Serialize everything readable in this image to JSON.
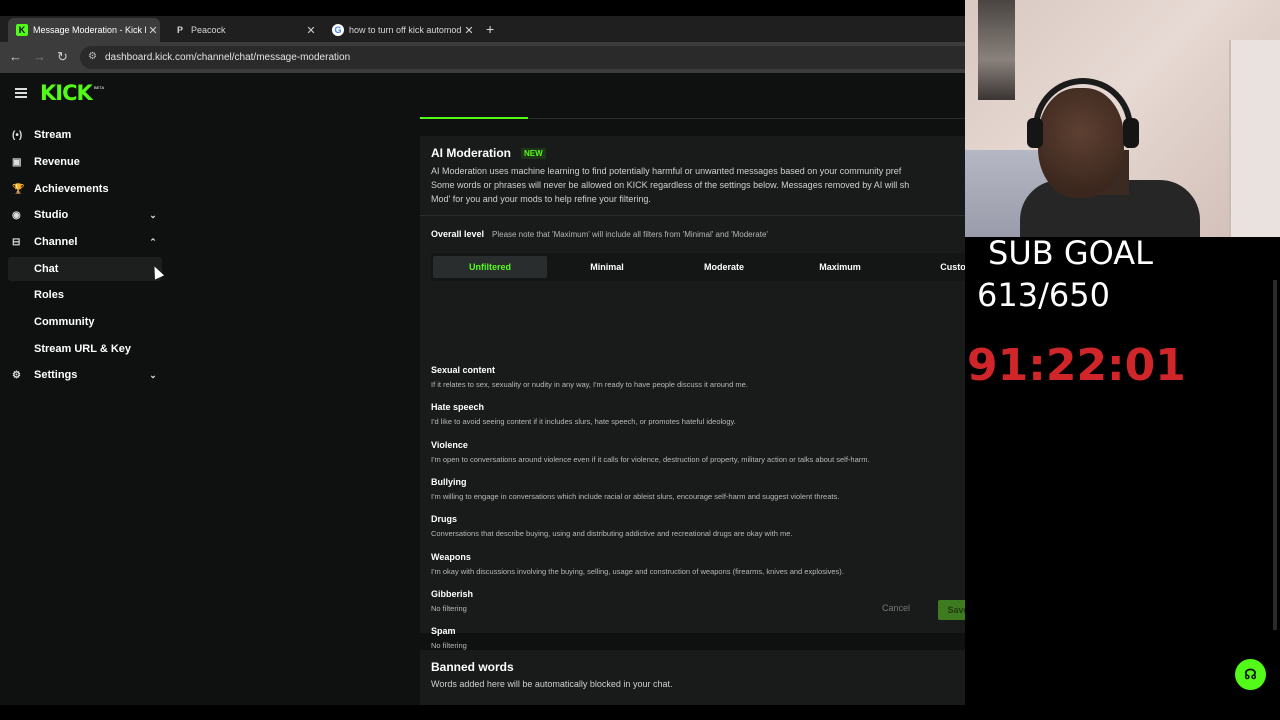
{
  "browser": {
    "tabs": [
      {
        "favicon": "K",
        "favicon_color": "#53fc18",
        "label": "Message Moderation - Kick Da"
      },
      {
        "favicon": "P",
        "favicon_color": "#ffffff",
        "label": "Peacock"
      },
      {
        "favicon": "G",
        "favicon_color": "#4285f4",
        "label": "how to turn off kick automod -"
      }
    ],
    "new_tab_icon": "+",
    "url": "dashboard.kick.com/channel/chat/message-moderation"
  },
  "brand": {
    "logo": "KICK",
    "badge": "BETA",
    "accent": "#53fc18"
  },
  "sidebar": {
    "items": [
      {
        "icon": "(•)",
        "label": "Stream"
      },
      {
        "icon": "▣",
        "label": "Revenue"
      },
      {
        "icon": "🏆",
        "label": "Achievements"
      },
      {
        "icon": "◉",
        "label": "Studio",
        "chevron": "⌄"
      },
      {
        "icon": "⊟",
        "label": "Channel",
        "chevron": "⌃"
      },
      {
        "label": "Chat"
      },
      {
        "label": "Roles"
      },
      {
        "label": "Community"
      },
      {
        "label": "Stream URL & Key"
      },
      {
        "icon": "⚙",
        "label": "Settings",
        "chevron": "⌄"
      }
    ]
  },
  "ai_moderation": {
    "title": "AI Moderation",
    "badge": "NEW",
    "description": [
      "AI Moderation uses machine learning to find potentially harmful or unwanted messages based on your community pref",
      "Some words or phrases will never be allowed on KICK regardless of the settings below. Messages removed by AI will sh",
      "Mod' for you and your mods to help refine your filtering."
    ],
    "overall_level_label": "Overall level",
    "overall_level_note": "Please note that 'Maximum' will include all filters from 'Minimal' and 'Moderate'",
    "levels": [
      "Unfiltered",
      "Minimal",
      "Moderate",
      "Maximum",
      "Custom"
    ],
    "categories": [
      {
        "title": "Sexual content",
        "desc": "If it relates to sex, sexuality or nudity in any way, I'm ready to have people discuss it around me."
      },
      {
        "title": "Hate speech",
        "desc": "I'd like to avoid seeing content if it includes slurs, hate speech, or promotes hateful ideology."
      },
      {
        "title": "Violence",
        "desc": "I'm open to conversations around violence even if it calls for violence, destruction of property, military action or talks about self-harm."
      },
      {
        "title": "Bullying",
        "desc": "I'm willing to engage in conversations which include racial or ableist slurs, encourage self-harm and suggest violent threats."
      },
      {
        "title": "Drugs",
        "desc": "Conversations that describe buying, using and distributing addictive and recreational drugs are okay with me."
      },
      {
        "title": "Weapons",
        "desc": "I'm okay with discussions involving the buying, selling, usage and construction of weapons (firearms, knives and explosives)."
      },
      {
        "title": "Gibberish",
        "desc": "No filtering"
      },
      {
        "title": "Spam",
        "desc": "No filtering"
      }
    ],
    "cancel_label": "Cancel",
    "save_label": "Save changes"
  },
  "banned_words": {
    "title": "Banned words",
    "desc": "Words added here will be automatically blocked in your chat."
  },
  "overlay": {
    "sub_goal_label": "SUB GOAL",
    "sub_goal_count": "613/650",
    "timer": "91:22:01"
  }
}
